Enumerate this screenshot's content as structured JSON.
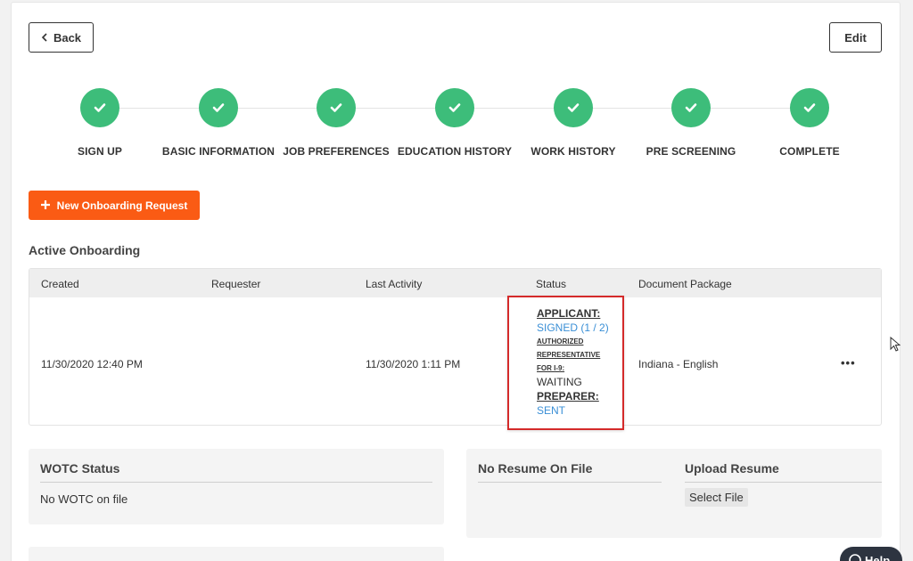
{
  "header": {
    "back_label": "Back",
    "edit_label": "Edit"
  },
  "steps": [
    {
      "label": "SIGN UP"
    },
    {
      "label": "BASIC INFORMATION"
    },
    {
      "label": "JOB PREFERENCES"
    },
    {
      "label": "EDUCATION HISTORY"
    },
    {
      "label": "WORK HISTORY"
    },
    {
      "label": "PRE SCREENING"
    },
    {
      "label": "COMPLETE"
    }
  ],
  "actions": {
    "new_onboarding_label": "New Onboarding Request"
  },
  "active_onboarding": {
    "title": "Active Onboarding",
    "columns": [
      "Created",
      "Requester",
      "Last Activity",
      "Status",
      "Document Package"
    ],
    "row": {
      "created": "11/30/2020 12:40 PM",
      "requester": "",
      "last_activity": "11/30/2020 1:11 PM",
      "status": {
        "applicant_label": "APPLICANT:",
        "applicant_value": "SIGNED (1 / 2)",
        "authorized_line1": "AUTHORIZED",
        "authorized_line2": "REPRESENTATIVE",
        "authorized_line3": "FOR I-9:",
        "authorized_value": "WAITING",
        "preparer_label": "PREPARER:",
        "preparer_value": "SENT"
      },
      "document_package": "Indiana - English",
      "menu_label": "•••"
    }
  },
  "wotc": {
    "title": "WOTC Status",
    "value": "No WOTC on file"
  },
  "resume": {
    "title": "No Resume On File"
  },
  "upload": {
    "title": "Upload Resume",
    "select_label": "Select File"
  },
  "help": {
    "label": "Help"
  },
  "colors": {
    "accent_orange": "#fa5b14",
    "step_green": "#3dbd7a",
    "link_blue": "#3a8fd6",
    "highlight_red": "#d42a2a"
  }
}
